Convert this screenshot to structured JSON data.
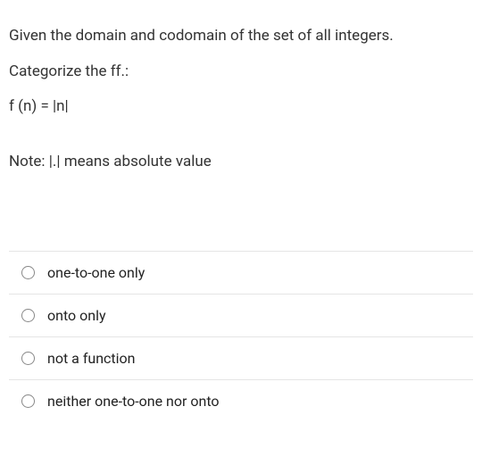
{
  "question": {
    "line1": "Given the domain and codomain of the set of all integers.",
    "line2": "Categorize the ff.:",
    "line3": "f (n) = |n|"
  },
  "note": "Note: |.| means absolute value",
  "options": [
    {
      "label": "one-to-one only"
    },
    {
      "label": "onto only"
    },
    {
      "label": "not a function"
    },
    {
      "label": "neither one-to-one nor onto"
    }
  ]
}
